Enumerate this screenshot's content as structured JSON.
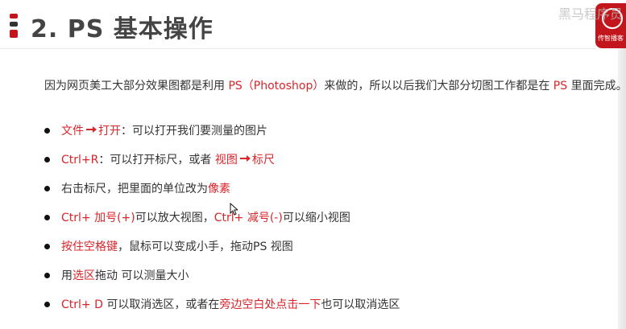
{
  "slide": {
    "title": "2. PS 基本操作",
    "watermark": "黑马程序员",
    "logo_text": "传智播客"
  },
  "intro": {
    "part1": "因为网页美工大部分效果图都是利用 ",
    "ps_red": "PS（Photoshop）",
    "part2": "来做的，所以以后我们大部分切图工作都是在 ",
    "ps_red2": "PS",
    "part3": " 里面完成。"
  },
  "bullets": [
    {
      "a_red": "文件",
      "b_red": "打开",
      "c": "：可以打开我们要测量的图片"
    },
    {
      "a_red": "Ctrl+R",
      "b": "：可以打开标尺，或者 ",
      "c_red": "视图",
      "d_red": "标尺"
    },
    {
      "a": "右击标尺，把里面的单位改为",
      "b_red": "像素"
    },
    {
      "a_red": "Ctrl+ 加号(+)",
      "b": "可以放大视图，",
      "c_red": "Ctrl+ 减号(-)",
      "d": "可以缩小视图"
    },
    {
      "a_red": "按住空格键",
      "b": "，鼠标可以变成小手，拖动PS 视图"
    },
    {
      "a": "用",
      "b_red": "选区",
      "c": "拖动 可以测量大小"
    },
    {
      "a_red": "Ctrl+ D",
      "b": " 可以取消选区，或者在",
      "c_red": "旁边空白处点击一下",
      "d": "也可以取消选区"
    }
  ],
  "colors": {
    "accent": "#d9242a",
    "brand": "#c3161c",
    "text": "#333333",
    "title": "#444444"
  },
  "icons": {
    "arrow": "right-arrow-icon",
    "bullet": "bullet-dot-icon",
    "cursor": "mouse-pointer-icon"
  }
}
